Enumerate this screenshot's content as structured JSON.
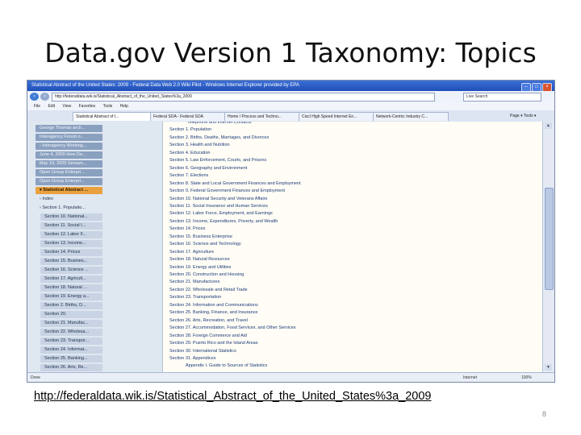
{
  "slide": {
    "title": "Data.gov Version 1 Taxonomy: Topics",
    "url_caption": "http://federaldata.wik.is/Statistical_Abstract_of_the_United_States%3a_2009",
    "page_number": "8"
  },
  "browser": {
    "window_title": "Statistical Abstract of the United States: 2009 - Federal Data Web 2.0 Wiki Pilot - Windows Internet Explorer provided by EPA",
    "address": "http://federaldata.wik.is/Statistical_Abstract_of_the_United_States%3a_2009",
    "search_placeholder": "Live Search",
    "menu": [
      "File",
      "Edit",
      "View",
      "Favorites",
      "Tools",
      "Help"
    ],
    "tabs": [
      "Statistical Abstract of t...",
      "Federal SOA - Federal SOA",
      "Home / Process and Techno...",
      "Ciscl High Speed Internet En...",
      "Network-Centric Industry C..."
    ],
    "tools_label": "Page ▾  Tools ▾",
    "status_left": "Done",
    "status_zone": "Internet",
    "status_zoom": "100%"
  },
  "sidebar": {
    "items": [
      {
        "label": "George Thomas arch...",
        "style": "pill"
      },
      {
        "label": "Interagency Forum o...",
        "style": "pill"
      },
      {
        "label": "› Interagency Working...",
        "style": "pill"
      },
      {
        "label": "June 4, 2009 How Do...",
        "style": "pill"
      },
      {
        "label": "May 19, 2009 Semam...",
        "style": "pill"
      },
      {
        "label": "Open Group Enterpri...",
        "style": "pill"
      },
      {
        "label": "Open Group Enterpri...",
        "style": "pill"
      },
      {
        "label": "▾ Statistical Abstract ...",
        "style": "active"
      },
      {
        "label": "› Index",
        "style": "plain"
      },
      {
        "label": "› Section 1. Populatio...",
        "style": "plain"
      },
      {
        "label": "Section 10. National...",
        "style": "sub"
      },
      {
        "label": "Section 11. Social I...",
        "style": "sub"
      },
      {
        "label": "Section 12. Labor F...",
        "style": "sub"
      },
      {
        "label": "Section 13. Income...",
        "style": "sub"
      },
      {
        "label": "Section 14. Prices",
        "style": "sub"
      },
      {
        "label": "Section 15. Busines...",
        "style": "sub"
      },
      {
        "label": "Section 16. Science ...",
        "style": "sub"
      },
      {
        "label": "Section 17. Agricult...",
        "style": "sub"
      },
      {
        "label": "Section 18. Natural ...",
        "style": "sub"
      },
      {
        "label": "Section 19. Energy a...",
        "style": "sub"
      },
      {
        "label": "Section 2. Births, D...",
        "style": "sub"
      },
      {
        "label": "Section 20.",
        "style": "sub"
      },
      {
        "label": "Section 21. Manufac...",
        "style": "sub"
      },
      {
        "label": "Section 22. Wholesa...",
        "style": "sub"
      },
      {
        "label": "Section 23. Transpor...",
        "style": "sub"
      },
      {
        "label": "Section 24. Informat...",
        "style": "sub"
      },
      {
        "label": "Section 25. Banking...",
        "style": "sub"
      },
      {
        "label": "Section 26. Arts, Re...",
        "style": "sub"
      }
    ]
  },
  "content": {
    "sections": [
      "Telephone and Internet Contacts",
      "Section 1. Population",
      "Section 2. Births, Deaths, Marriages, and Divorces",
      "Section 3. Health and Nutrition",
      "Section 4. Education",
      "Section 5. Law Enforcement, Courts, and Prisons",
      "Section 6. Geography and Environment",
      "Section 7. Elections",
      "Section 8. State and Local Government Finances and Employment",
      "Section 9. Federal Government Finances and Employment",
      "Section 10. National Security and Veterans Affairs",
      "Section 11. Social Insurance and Human Services",
      "Section 12. Labor Force, Employment, and Earnings",
      "Section 13. Income, Expenditures, Poverty, and Wealth",
      "Section 14. Prices",
      "Section 15. Business Enterprise",
      "Section 16. Science and Technology",
      "Section 17. Agriculture",
      "Section 18. Natural Resources",
      "Section 19. Energy and Utilities",
      "Section 20. Construction and Housing",
      "Section 21. Manufactures",
      "Section 22. Wholesale and Retail Trade",
      "Section 23. Transportation",
      "Section 24. Information and Communications",
      "Section 25. Banking, Finance, and Insurance",
      "Section 26. Arts, Recreation, and Travel",
      "Section 27. Accommodation, Food Services, and Other Services",
      "Section 28. Foreign Commerce and Aid",
      "Section 29. Puerto Rico and the Island Areas",
      "Section 30. International Statistics",
      "Section 31. Appendices",
      "Appendix I. Guide to Sources of Statistics"
    ]
  },
  "colors": {
    "accent_tab": "#e9a13f",
    "link_blue": "#1b3a7a",
    "sidebar_bg": "#dfe7f1",
    "title_bar": "#1f4fb8"
  }
}
